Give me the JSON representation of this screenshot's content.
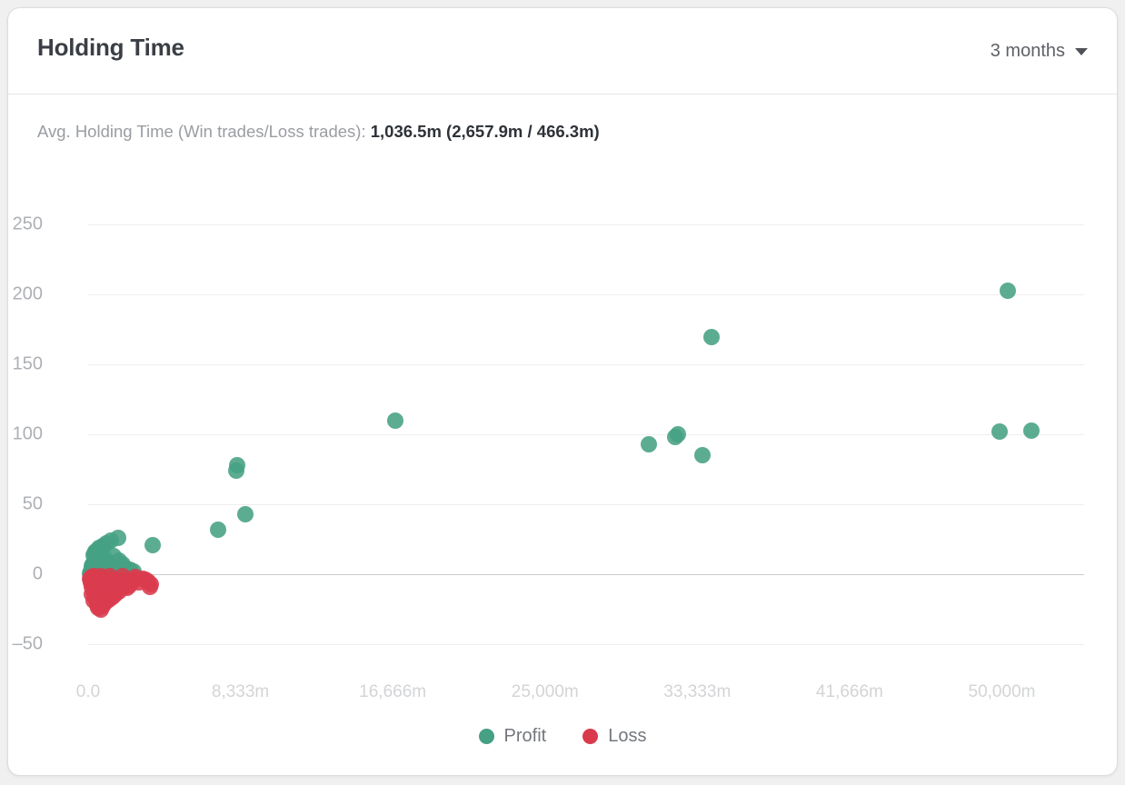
{
  "card": {
    "title": "Holding Time",
    "range_dropdown": {
      "selected": "3 months",
      "icon": "chevron-down-icon"
    },
    "summary": {
      "label": "Avg. Holding Time (Win trades/Loss trades):",
      "value": "1,036.5m (2,657.9m / 466.3m)"
    }
  },
  "colors": {
    "profit": "#46a083",
    "loss": "#d93b4d",
    "grid": "#eeeeee",
    "zero_line": "#cbcbcb",
    "title": "#3b3f45",
    "muted_text": "#9a9da2"
  },
  "legend": [
    {
      "label": "Profit",
      "color": "#46a083",
      "key": "profit"
    },
    {
      "label": "Loss",
      "color": "#d93b4d",
      "key": "loss"
    }
  ],
  "chart_data": {
    "type": "scatter",
    "title": "Holding Time",
    "xlabel": "",
    "ylabel": "",
    "grid": true,
    "legend_position": "bottom",
    "xlim": [
      0,
      54500
    ],
    "ylim": [
      -50,
      262
    ],
    "xticks": [
      0,
      8333,
      16666,
      25000,
      33333,
      41666,
      50000
    ],
    "xticklabels": [
      "0.0",
      "8,333m",
      "16,666m",
      "25,000m",
      "33,333m",
      "41,666m",
      "50,000m"
    ],
    "yticks": [
      -50,
      0,
      50,
      100,
      150,
      200,
      250
    ],
    "yticklabels": [
      "‒50",
      "0",
      "50",
      "100",
      "150",
      "200",
      "250"
    ],
    "point_radius": 9,
    "series": [
      {
        "name": "Profit",
        "color": "#46a083",
        "points": [
          [
            50300,
            203
          ],
          [
            34100,
            170
          ],
          [
            16800,
            110
          ],
          [
            49900,
            102
          ],
          [
            51600,
            103
          ],
          [
            32100,
            98
          ],
          [
            32250,
            100
          ],
          [
            30700,
            93
          ],
          [
            33600,
            85
          ],
          [
            8150,
            78
          ],
          [
            8100,
            74
          ],
          [
            8600,
            43
          ],
          [
            7100,
            32
          ],
          [
            3550,
            21
          ],
          [
            1650,
            26
          ],
          [
            1250,
            24
          ],
          [
            1000,
            22
          ],
          [
            800,
            20
          ],
          [
            600,
            19
          ],
          [
            500,
            17
          ],
          [
            420,
            16
          ],
          [
            350,
            15
          ],
          [
            300,
            14
          ],
          [
            1400,
            13
          ],
          [
            900,
            12
          ],
          [
            700,
            11
          ],
          [
            550,
            10
          ],
          [
            1700,
            10
          ],
          [
            400,
            9
          ],
          [
            300,
            8
          ],
          [
            1100,
            8
          ],
          [
            250,
            7
          ],
          [
            1900,
            7
          ],
          [
            600,
            6
          ],
          [
            200,
            6
          ],
          [
            1500,
            5
          ],
          [
            350,
            5
          ],
          [
            2100,
            4
          ],
          [
            800,
            4
          ],
          [
            180,
            4
          ],
          [
            1250,
            3
          ],
          [
            450,
            3
          ],
          [
            2300,
            3
          ],
          [
            150,
            2
          ],
          [
            950,
            2
          ],
          [
            1750,
            2
          ],
          [
            300,
            2
          ],
          [
            2500,
            2
          ],
          [
            120,
            1
          ],
          [
            650,
            1
          ],
          [
            1450,
            1
          ],
          [
            2050,
            1
          ],
          [
            380,
            1
          ]
        ]
      },
      {
        "name": "Loss",
        "color": "#d93b4d",
        "points": [
          [
            300,
            -1
          ],
          [
            700,
            -1
          ],
          [
            1200,
            -1
          ],
          [
            1900,
            -1
          ],
          [
            2600,
            -2
          ],
          [
            3000,
            -3
          ],
          [
            3300,
            -5
          ],
          [
            3450,
            -7
          ],
          [
            3400,
            -9
          ],
          [
            200,
            -2
          ],
          [
            500,
            -3
          ],
          [
            900,
            -3
          ],
          [
            1400,
            -4
          ],
          [
            2000,
            -4
          ],
          [
            2400,
            -5
          ],
          [
            150,
            -4
          ],
          [
            400,
            -5
          ],
          [
            800,
            -6
          ],
          [
            1300,
            -6
          ],
          [
            1800,
            -6
          ],
          [
            2200,
            -7
          ],
          [
            250,
            -7
          ],
          [
            600,
            -8
          ],
          [
            1000,
            -8
          ],
          [
            1550,
            -9
          ],
          [
            2000,
            -9
          ],
          [
            180,
            -9
          ],
          [
            450,
            -10
          ],
          [
            850,
            -11
          ],
          [
            1250,
            -11
          ],
          [
            1700,
            -12
          ],
          [
            2150,
            -10
          ],
          [
            300,
            -12
          ],
          [
            650,
            -13
          ],
          [
            1100,
            -13
          ],
          [
            1500,
            -14
          ],
          [
            220,
            -14
          ],
          [
            520,
            -15
          ],
          [
            950,
            -15
          ],
          [
            1350,
            -16
          ],
          [
            400,
            -17
          ],
          [
            750,
            -17
          ],
          [
            1150,
            -18
          ],
          [
            320,
            -19
          ],
          [
            600,
            -20
          ],
          [
            950,
            -20
          ],
          [
            480,
            -22
          ],
          [
            780,
            -23
          ],
          [
            560,
            -24
          ],
          [
            680,
            -25
          ],
          [
            1050,
            -15
          ],
          [
            1600,
            -10
          ],
          [
            2300,
            -8
          ],
          [
            2800,
            -6
          ],
          [
            3150,
            -4
          ],
          [
            130,
            -6
          ],
          [
            100,
            -3
          ],
          [
            1450,
            -8
          ],
          [
            1850,
            -7
          ],
          [
            2550,
            -4
          ]
        ]
      }
    ]
  }
}
